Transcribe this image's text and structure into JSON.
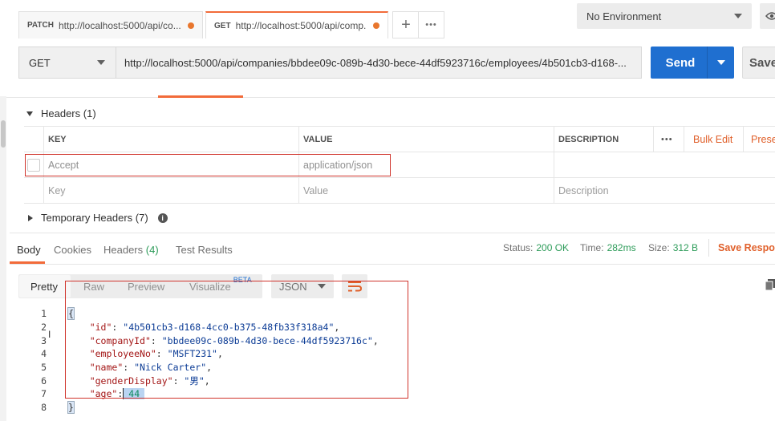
{
  "tabs": [
    {
      "method": "PATCH",
      "url": "http://localhost:5000/api/co..."
    },
    {
      "method": "GET",
      "url": "http://localhost:5000/api/comp..."
    }
  ],
  "tab_actions": {
    "add": "+",
    "more": "•••"
  },
  "environment": {
    "selected": "No Environment"
  },
  "request": {
    "method": "GET",
    "url": "http://localhost:5000/api/companies/bbdee09c-089b-4d30-bece-44df5923716c/employees/4b501cb3-d168-...",
    "send_label": "Send",
    "save_label": "Save"
  },
  "headers_section": {
    "title": "Headers",
    "count": "(1)",
    "columns": {
      "key": "KEY",
      "value": "VALUE",
      "description": "DESCRIPTION"
    },
    "more": "•••",
    "bulk_edit": "Bulk Edit",
    "presets": "Prese",
    "rows": [
      {
        "key": "Accept",
        "value": "application/json"
      }
    ],
    "placeholder": {
      "key": "Key",
      "value": "Value",
      "description": "Description"
    }
  },
  "temp_headers": {
    "title": "Temporary Headers",
    "count": "(7)"
  },
  "response": {
    "tabs": {
      "body": "Body",
      "cookies": "Cookies",
      "headers": "Headers",
      "headers_count": "(4)",
      "tests": "Test Results"
    },
    "status_label": "Status:",
    "status_value": "200 OK",
    "time_label": "Time:",
    "time_value": "282ms",
    "size_label": "Size:",
    "size_value": "312 B",
    "save_response": "Save Respor",
    "views": {
      "pretty": "Pretty",
      "raw": "Raw",
      "preview": "Preview",
      "visualize": "Visualize",
      "beta": "BETA"
    },
    "format": "JSON",
    "colors": {
      "accent": "#f26b3a",
      "send": "#1f6fd0",
      "status_ok": "#2e9c5a",
      "highlight_box": "#d0342c"
    },
    "body_lines": [
      {
        "n": "1",
        "key": "",
        "value": "",
        "open": "{"
      },
      {
        "n": "2",
        "key": "\"id\"",
        "value": "\"4b501cb3-d168-4cc0-b375-48fb33f318a4\"",
        "comma": ","
      },
      {
        "n": "3",
        "key": "\"companyId\"",
        "value": "\"bbdee09c-089b-4d30-bece-44df5923716c\"",
        "comma": ","
      },
      {
        "n": "4",
        "key": "\"employeeNo\"",
        "value": "\"MSFT231\"",
        "comma": ","
      },
      {
        "n": "5",
        "key": "\"name\"",
        "value": "\"Nick Carter\"",
        "comma": ","
      },
      {
        "n": "6",
        "key": "\"genderDisplay\"",
        "value": "\"男\"",
        "comma": ","
      },
      {
        "n": "7",
        "key": "\"age\"",
        "value": "44",
        "comma": ""
      },
      {
        "n": "8",
        "key": "",
        "value": "",
        "open": "}"
      }
    ]
  }
}
